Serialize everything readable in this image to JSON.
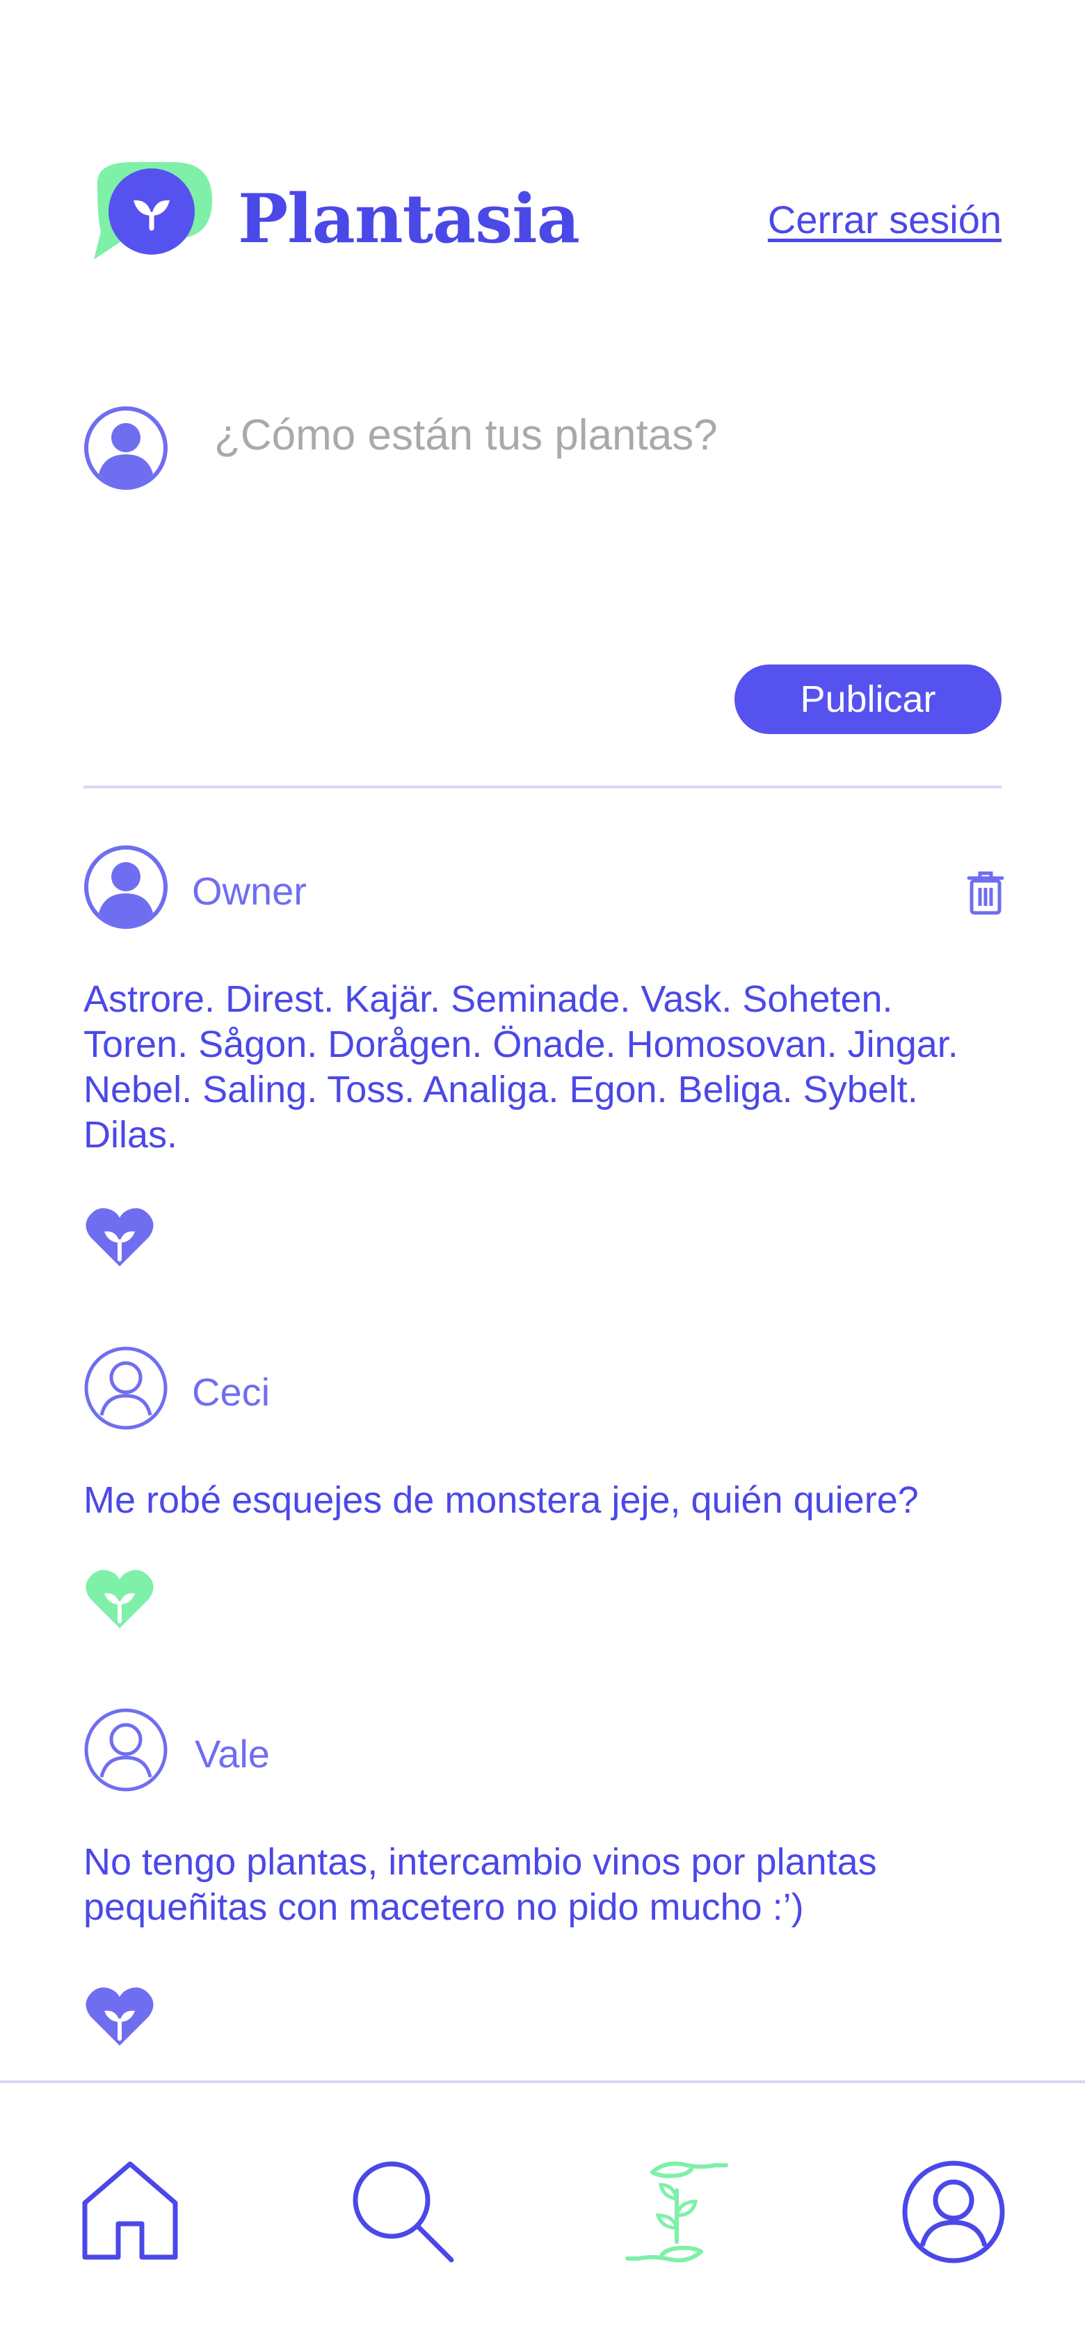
{
  "app": {
    "brand": "Plantasia",
    "logout_label": "Cerrar sesión"
  },
  "composer": {
    "placeholder": "¿Cómo están tus plantas?",
    "value": "",
    "publish_label": "Publicar"
  },
  "posts": [
    {
      "author": "Owner",
      "text": "Astrore. Direst. Kajär. Seminade. Vask. Soheten. Toren. Sågon. Dorågen. Önade. Homosovan. Jingar. Nebel. Saling. Toss. Analiga. Egon. Beliga. Sybelt. Dilas.",
      "liked": false,
      "deletable": true,
      "avatar_style": "filled"
    },
    {
      "author": "Ceci",
      "text": "Me robé esquejes de monstera jeje, quién quiere?",
      "liked": true,
      "deletable": false,
      "avatar_style": "outline"
    },
    {
      "author": "Vale",
      "text": "No tengo plantas, intercambio vinos por plantas pequeñitas con macetero no pido mucho :’)",
      "liked": false,
      "deletable": false,
      "avatar_style": "outline"
    }
  ],
  "nav": {
    "items": [
      "home-icon",
      "search-icon",
      "plant-exchange-icon",
      "profile-icon"
    ],
    "active": "plant-exchange-icon"
  },
  "colors": {
    "primary": "#4b48e8",
    "accent_light": "#6f6ef0",
    "mint": "#7ef0a8",
    "divider": "#d6d6f7",
    "placeholder": "#a9a9ad"
  }
}
